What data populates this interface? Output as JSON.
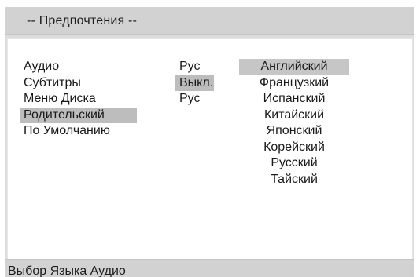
{
  "header": {
    "title": "-- Предпочтения --"
  },
  "settings": [
    {
      "label": "Аудио",
      "value": "Рус"
    },
    {
      "label": "Субтитры",
      "value": "Выкл."
    },
    {
      "label": "Меню Диска",
      "value": "Рус"
    },
    {
      "label": "Родительский",
      "value": ""
    },
    {
      "label": "По Умолчанию",
      "value": ""
    }
  ],
  "selected_setting": "Родительский",
  "selected_value": "Выкл.",
  "languages": [
    "Английский",
    "Французкий",
    "Испанский",
    "Китайский",
    "Японский",
    "Корейский",
    "Русский",
    "Тайский"
  ],
  "highlighted_language": "Английский",
  "status_bar": {
    "text": "Выбор Языка Аудио"
  },
  "colors": {
    "panel_bg": "#dcdcdc",
    "content_bg": "#ffffff",
    "highlight": "#bdbdbd",
    "text": "#1a1a1a"
  }
}
